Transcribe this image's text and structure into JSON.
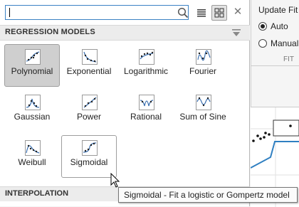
{
  "background_app": {
    "update_fit_title": "Update Fit",
    "radio_auto": "Auto",
    "radio_manual": "Manual",
    "fit_caption": "FIT"
  },
  "popup": {
    "search": {
      "value": "",
      "placeholder": ""
    },
    "view_buttons": {
      "list": "list-view-icon",
      "grid": "grid-view-icon",
      "active": "grid"
    },
    "close_icon": "close-icon",
    "regression_header": "REGRESSION MODELS",
    "models": [
      {
        "label": "Polynomial",
        "icon": "polynomial-icon",
        "state": "selected"
      },
      {
        "label": "Exponential",
        "icon": "exponential-icon",
        "state": "normal"
      },
      {
        "label": "Logarithmic",
        "icon": "logarithmic-icon",
        "state": "normal"
      },
      {
        "label": "Fourier",
        "icon": "fourier-icon",
        "state": "normal"
      },
      {
        "label": "Gaussian",
        "icon": "gaussian-icon",
        "state": "normal"
      },
      {
        "label": "Power",
        "icon": "power-icon",
        "state": "normal"
      },
      {
        "label": "Rational",
        "icon": "rational-icon",
        "state": "normal"
      },
      {
        "label": "Sum of Sine",
        "icon": "sum-of-sine-icon",
        "state": "normal"
      },
      {
        "label": "Weibull",
        "icon": "weibull-icon",
        "state": "normal"
      },
      {
        "label": "Sigmoidal",
        "icon": "sigmoidal-icon",
        "state": "hover"
      }
    ],
    "interpolation_header": "INTERPOLATION"
  },
  "tooltip": "Sigmoidal - Fit a logistic or Gompertz model",
  "colors": {
    "accent": "#3b82c4",
    "selected_tile": "#cfcfcf",
    "plot_line": "#2f7fc1"
  }
}
